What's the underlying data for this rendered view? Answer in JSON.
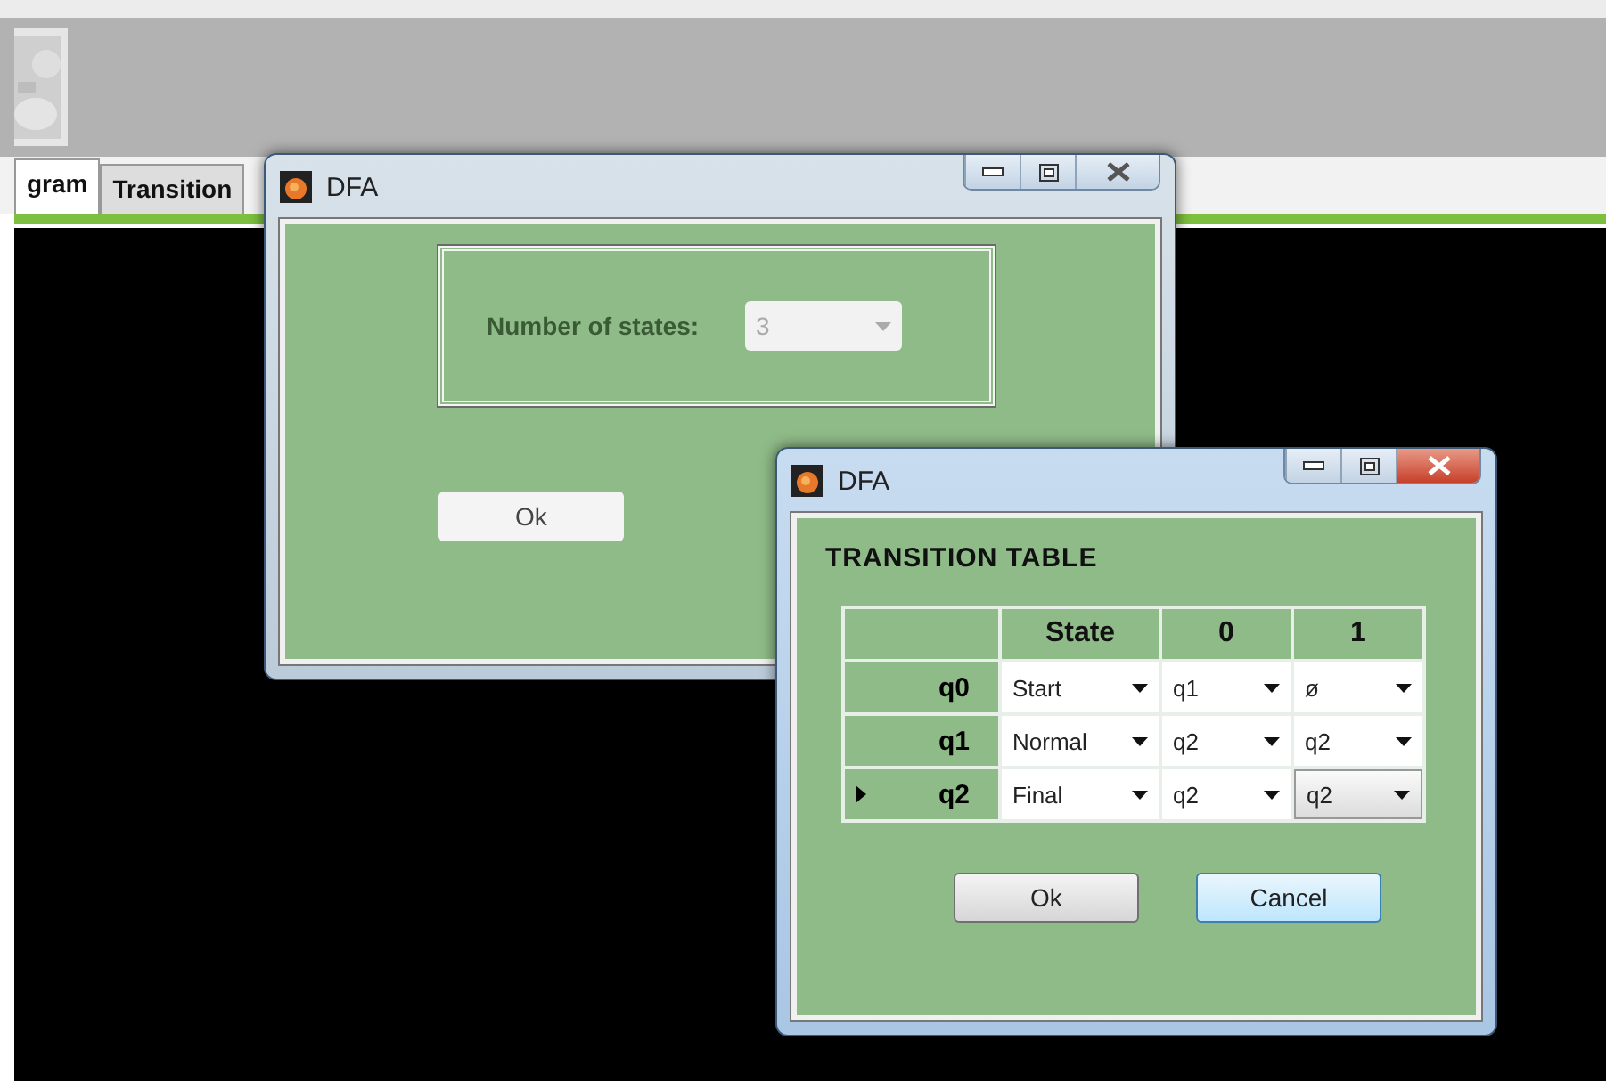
{
  "main_window": {
    "tabs": [
      {
        "label": "gram",
        "selected": true
      },
      {
        "label": "Transition",
        "selected": false
      }
    ]
  },
  "states_dialog": {
    "title": "DFA",
    "active": false,
    "label": "Number of states:",
    "combo": {
      "value": "3",
      "disabled": true
    },
    "ok_button": "Ok"
  },
  "table_dialog": {
    "title": "DFA",
    "active": true,
    "heading": "TRANSITION TABLE",
    "columns": [
      "State",
      "0",
      "1"
    ],
    "rows": [
      {
        "name": "q0",
        "selected": false,
        "cells": [
          {
            "value": "Start",
            "focused": false
          },
          {
            "value": "q1",
            "focused": false
          },
          {
            "value": "ø",
            "focused": false
          }
        ]
      },
      {
        "name": "q1",
        "selected": false,
        "cells": [
          {
            "value": "Normal",
            "focused": false
          },
          {
            "value": "q2",
            "focused": false
          },
          {
            "value": "q2",
            "focused": false
          }
        ]
      },
      {
        "name": "q2",
        "selected": true,
        "cells": [
          {
            "value": "Final",
            "focused": false
          },
          {
            "value": "q2",
            "focused": false
          },
          {
            "value": "q2",
            "focused": true
          }
        ]
      }
    ],
    "buttons": [
      {
        "label": "Ok",
        "focused": false
      },
      {
        "label": "Cancel",
        "focused": true
      }
    ]
  }
}
